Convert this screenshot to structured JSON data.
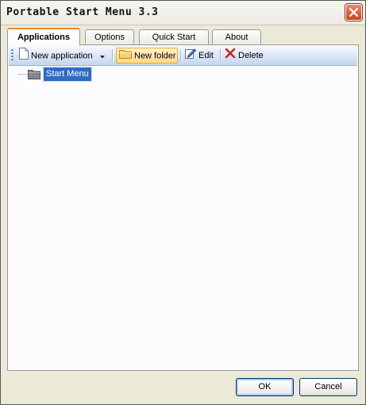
{
  "window": {
    "title": "Portable Start Menu 3.3"
  },
  "tabs": [
    {
      "label": "Applications",
      "active": true
    },
    {
      "label": "Options",
      "active": false
    },
    {
      "label": "Quick Start",
      "active": false
    },
    {
      "label": "About",
      "active": false
    }
  ],
  "toolbar": {
    "new_application": "New application",
    "new_folder": "New folder",
    "edit": "Edit",
    "delete": "Delete"
  },
  "tree": {
    "root_label": "Start Menu",
    "root_selected": true
  },
  "footer": {
    "ok_label": "OK",
    "cancel_label": "Cancel"
  },
  "colors": {
    "selection": "#316ac5",
    "active_tab_accent": "#e68b2c",
    "close_button": "#c8431c"
  },
  "icons": [
    "close-icon",
    "new-application-icon",
    "dropdown-arrow-icon",
    "folder-icon",
    "edit-icon",
    "delete-icon",
    "folder-icon"
  ]
}
